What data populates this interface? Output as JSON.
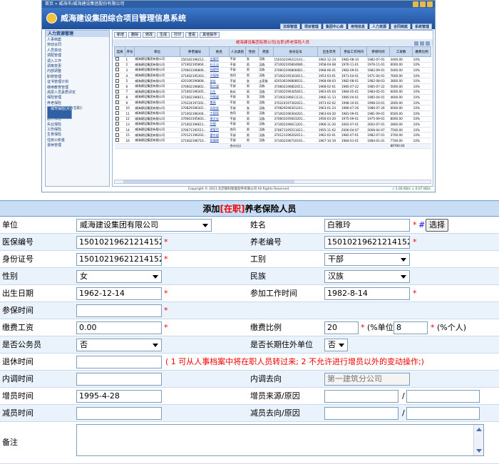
{
  "thumb": {
    "breadcrumb": "首页 » 威海市/威海建设集团股份有限公司",
    "title": "威海建设集团综合项目管理信息系统",
    "nav": [
      "法规管理",
      "项目管理",
      "集团中心库",
      "用地信息",
      "人力资源",
      "合同档案",
      "系统管理"
    ],
    "left_header": "人力资源管理",
    "tree": [
      "人事档案",
      "劳动合同",
      "人员变动",
      "调配管理",
      "调入工作",
      "调离变更",
      "内部调整",
      "职称管理",
      "证书管理计划",
      "继续教育管理",
      "高层人员素质评定",
      "保险管理",
      "养老保险",
      "城市保险(月)",
      "养老保险卡上缴(在职)",
      "人员退休手续",
      "医疗保险",
      "失业保险",
      "工伤保险",
      "生育保险",
      "住房公积金",
      "退休管理"
    ],
    "tree_selected": "城市保险(月)",
    "toolbar": [
      "新增",
      "删除",
      "修改",
      "生成",
      "打印",
      "查看",
      "其他操作"
    ],
    "table_title": "威海建设集团有限公司[在职]养老保险人员",
    "columns": [
      "选择",
      "序号",
      "单位",
      "养老编号",
      "姓名",
      "人员类别",
      "性别",
      "民族",
      "身份证号",
      "出生年月",
      "参加工作时间",
      "参保时间",
      "工资数",
      "缴费比例"
    ],
    "rows": [
      [
        "1",
        "威海建设集团有限公司",
        "150102196212...",
        "白雅玲",
        "干部",
        "女",
        "汉族",
        "150102196212141...",
        "1962-12-14",
        "1982-08-14",
        "1982-07-01",
        "3400.00",
        "10%"
      ],
      [
        "2",
        "威海建设集团有限公司",
        "371002195804...",
        "杜玉洁",
        "干部",
        "男",
        "汉族",
        "371002195804080...",
        "1958-04-08",
        "1976-11-01",
        "1976-11-01",
        "6000.00",
        "10%"
      ],
      [
        "3",
        "威海建设集团有限公司",
        "370603196806...",
        "钱建明",
        "干部",
        "男",
        "汉族",
        "370603196806081...",
        "1968-06-01",
        "1982-09-01",
        "1982-09-01",
        "5000.00",
        "10%"
      ],
      [
        "4",
        "威海建设集团有限公司",
        "371002195303...",
        "许福林",
        "合同",
        "男",
        "汉族",
        "371002195303011...",
        "1953-03-01",
        "1971-04-01",
        "1971-04-01",
        "7600.00",
        "10%"
      ],
      [
        "5",
        "威海建设集团有限公司",
        "420106196808...",
        "张宏",
        "干部",
        "女",
        "土家族",
        "420106196808031...",
        "1968-08-03",
        "1982-08-01",
        "1982-08-03",
        "3800.00",
        "10%"
      ],
      [
        "6",
        "威海建设集团有限公司",
        "370602196802...",
        "陈力波",
        "干部",
        "男",
        "汉族",
        "370602196802011...",
        "1968-02-01",
        "1985-07-22",
        "1985-07-22",
        "5000.00",
        "10%"
      ],
      [
        "7",
        "威海建设集团有限公司",
        "371002196305...",
        "孔生",
        "协议",
        "男",
        "汉族",
        "371002196305041...",
        "1963-05-04",
        "1984-05-01",
        "1984-05-01",
        "6000.00",
        "10%"
      ],
      [
        "8",
        "威海建设集团有限公司",
        "371002196611...",
        "孙丽姿",
        "干部",
        "女",
        "汉族",
        "371002196611131...",
        "1966-11-13",
        "1985-04-01",
        "1985-04-01",
        "4600.00",
        "10%"
      ],
      [
        "9",
        "威海建设集团有限公司",
        "370224197302...",
        "董高",
        "干部",
        "男",
        "汉族",
        "370224197302021...",
        "1973-02-02",
        "1998-10-01",
        "1998-10-01",
        "2600.00",
        "10%"
      ],
      [
        "10",
        "威海建设集团有限公司",
        "370829196301...",
        "邓欣欣",
        "干部",
        "女",
        "汉族",
        "370829196301241...",
        "1963-01-24",
        "1986-07-26",
        "1986-07-26",
        "6000.00",
        "10%"
      ],
      [
        "11",
        "威海建设集团有限公司",
        "371002196304...",
        "丁国亮",
        "合同",
        "男",
        "汉族",
        "371002196304201...",
        "1963-04-20",
        "1981-09-01",
        "1981-09-01",
        "6500.00",
        "10%"
      ],
      [
        "12",
        "威海建设集团有限公司",
        "370603195603...",
        "黄文忠",
        "干部",
        "男",
        "汉族",
        "370603195603201...",
        "1956-03-20",
        "1975-09-01",
        "1975-09-01",
        "8000.00",
        "10%"
      ],
      [
        "13",
        "威海建设集团有限公司",
        "371002196611...",
        "孙国",
        "干部",
        "男",
        "汉族",
        "371002196611201...",
        "1966-11-20",
        "2002-07-01",
        "2002-07-01",
        "2800.00",
        "10%"
      ],
      [
        "14",
        "威海建设集团有限公司",
        "370671195511...",
        "谢爱玲",
        "合同",
        "男",
        "汉族",
        "370671195511021...",
        "1955-11-02",
        "2006-04-07",
        "2006-04-07",
        "7500.00",
        "10%"
      ],
      [
        "15",
        "威海建设集团有限公司",
        "370121196202...",
        "雷中斌",
        "干部",
        "男",
        "汉族",
        "370121196202011...",
        "1962-02-01",
        "1982-07-01",
        "1982-07-01",
        "3700.00",
        "10%"
      ],
      [
        "16",
        "威海建设集团有限公司",
        "371002196710...",
        "张福林",
        "干部",
        "男",
        "汉族",
        "371002196710191...",
        "1967-10-19",
        "1984-01-01",
        "1984-01-01",
        "7700.00",
        "10%"
      ]
    ],
    "total_label": "合计(元)",
    "total_value": "89700.00",
    "copyright": "Copyright © 2011 北京联科智能软件有限公司 All Rights Reserved",
    "status_ok": "√ 1.00 KB/s",
    "status_speed": "↓ 0.07 KB/s"
  },
  "form": {
    "title_prefix": "添加",
    "title_status": "[在职]",
    "title_suffix": "养老保险人员",
    "unit_label": "单位",
    "unit_value": "威海建设集团有限公司",
    "name_label": "姓名",
    "name_value": "白雅玲",
    "select_button": "选择",
    "medical_label": "医保编号",
    "medical_value": "150102196212141525",
    "pension_label": "养老编号",
    "pension_value": "150102196212141525",
    "id_label": "身份证号",
    "id_value": "15010219621214152",
    "worktype_label": "工别",
    "worktype_value": "干部",
    "gender_label": "性别",
    "gender_value": "女",
    "ethnic_label": "民族",
    "ethnic_value": "汉族",
    "birth_label": "出生日期",
    "birth_value": "1962-12-14",
    "workstart_label": "参加工作时间",
    "workstart_value": "1982-8-14",
    "insured_label": "参保时间",
    "insured_value": "",
    "wage_label": "缴费工资",
    "wage_value": "0.00",
    "ratio_label": "缴费比例",
    "ratio_unit_value": "20",
    "ratio_unit_text": "(%单位);",
    "ratio_person_value": "8",
    "ratio_person_text": "(%个人)",
    "civil_label": "是否公务员",
    "civil_value": "否",
    "longterm_label": "是否长期住外单位",
    "longterm_value": "否",
    "retire_label": "退休时间",
    "retire_value": "",
    "retire_note": "( 1 可从人事档案中将在职人员转过来; 2 不允许进行增员以外的变动操作;)",
    "transfer_time_label": "内调时间",
    "transfer_time_value": "",
    "transfer_dir_label": "内调去向",
    "transfer_dir_value": "第一建筑分公司",
    "add_time_label": "增员时间",
    "add_time_value": "1995-4-28",
    "add_source_label": "增员来源/原因",
    "reduce_time_label": "减员时间",
    "reduce_time_value": "",
    "reduce_dest_label": "减员去向/原因",
    "remark_label": "备注",
    "required_mark": "*",
    "slash": "/",
    "hash": "#"
  }
}
